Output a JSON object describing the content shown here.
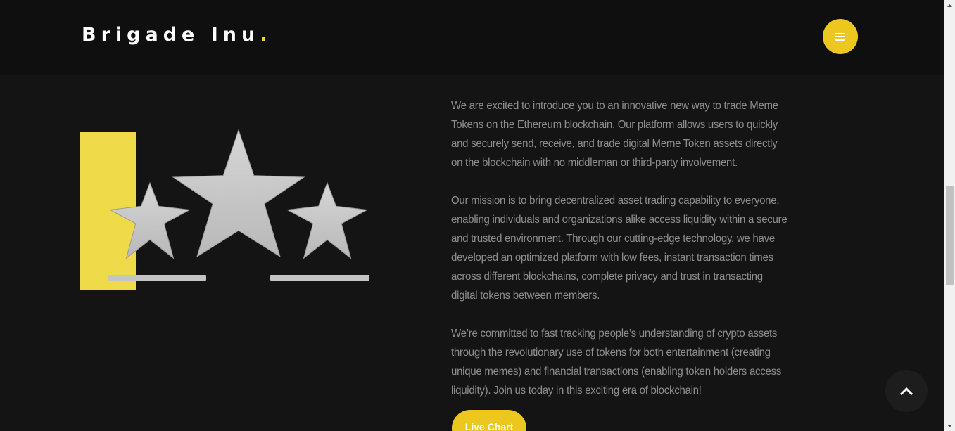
{
  "header": {
    "logo_text": "Brigade Inu",
    "logo_dot": ".",
    "menu_icon": "hamburger-icon"
  },
  "illustration": {
    "icon": "three-stars-rating-illustration"
  },
  "main": {
    "paragraphs": [
      "We are excited to introduce you to an innovative new way to trade Meme Tokens on the Ethereum blockchain. Our platform allows users to quickly and securely send, receive, and trade digital Meme Token assets directly on the blockchain with no middleman or third-party involvement.",
      "Our mission is to bring decentralized asset trading capability to everyone, enabling individuals and organizations alike access liquidity within a secure and trusted environment. Through our cutting-edge technology, we have developed an optimized platform with low fees, instant transaction times across different blockchains, complete privacy and trust in transacting digital tokens between members.",
      "We’re committed to fast tracking people’s understanding of crypto assets through the revolutionary use of tokens for both entertainment (creating unique memes) and financial transactions (enabling token holders access liquidity). Join us today in this exciting era of blockchain!"
    ],
    "live_chart_label": "Live Chart"
  },
  "back_to_top": {
    "icon": "chevron-up-icon"
  },
  "colors": {
    "accent": "#ecc81e",
    "background": "#141414",
    "header_background": "#0f0f0f",
    "body_text": "#8e8e8e",
    "star_gray": "#c8c8c8"
  }
}
